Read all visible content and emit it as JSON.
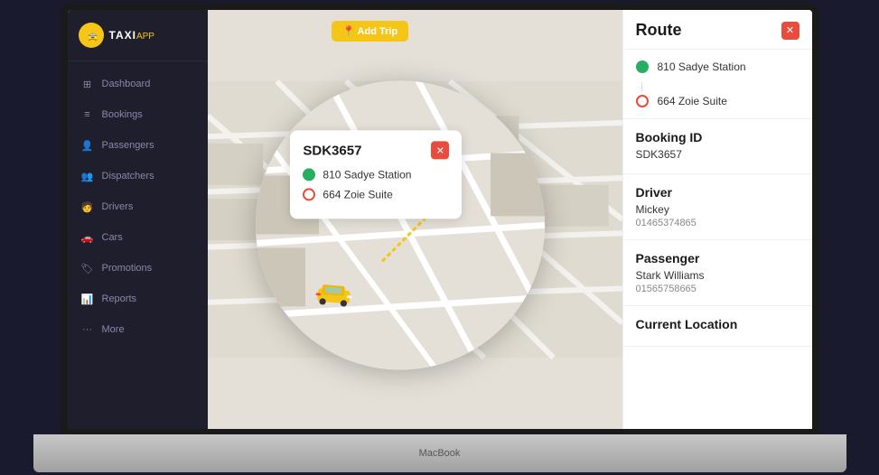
{
  "app": {
    "name": "TAXI",
    "subname": "APP",
    "macbook_label": "MacBook"
  },
  "sidebar": {
    "items": [
      {
        "label": "Dashboard",
        "icon": "⊞",
        "active": false
      },
      {
        "label": "Bookings",
        "icon": "📋",
        "active": false
      },
      {
        "label": "Passengers",
        "icon": "👤",
        "active": false
      },
      {
        "label": "Dispatchers",
        "icon": "👥",
        "active": false
      },
      {
        "label": "Drivers",
        "icon": "🚗",
        "active": false
      },
      {
        "label": "Cars",
        "icon": "🚘",
        "active": false
      },
      {
        "label": "Promotions",
        "icon": "🏷",
        "active": false
      },
      {
        "label": "Reports",
        "icon": "📊",
        "active": false
      },
      {
        "label": "More",
        "icon": "...",
        "active": false
      }
    ]
  },
  "map": {
    "action_btn": "Add Trip",
    "popup": {
      "id": "SDK3657",
      "close_icon": "✕",
      "route": [
        {
          "label": "810 Sadye Station",
          "type": "green"
        },
        {
          "label": "664 Zoie Suite",
          "type": "red"
        }
      ]
    }
  },
  "detail_panel": {
    "title": "Route",
    "close_icon": "✕",
    "route": [
      {
        "label": "810 Sadye Station",
        "type": "green"
      },
      {
        "label": "664 Zoie Suite",
        "type": "red"
      }
    ],
    "booking": {
      "label": "Booking ID",
      "value": "SDK3657"
    },
    "driver": {
      "label": "Driver",
      "name": "Mickey",
      "phone": "01465374865"
    },
    "passenger": {
      "label": "Passenger",
      "name": "Stark Williams",
      "phone": "01565758665"
    },
    "current_location": {
      "label": "Current Location"
    }
  }
}
